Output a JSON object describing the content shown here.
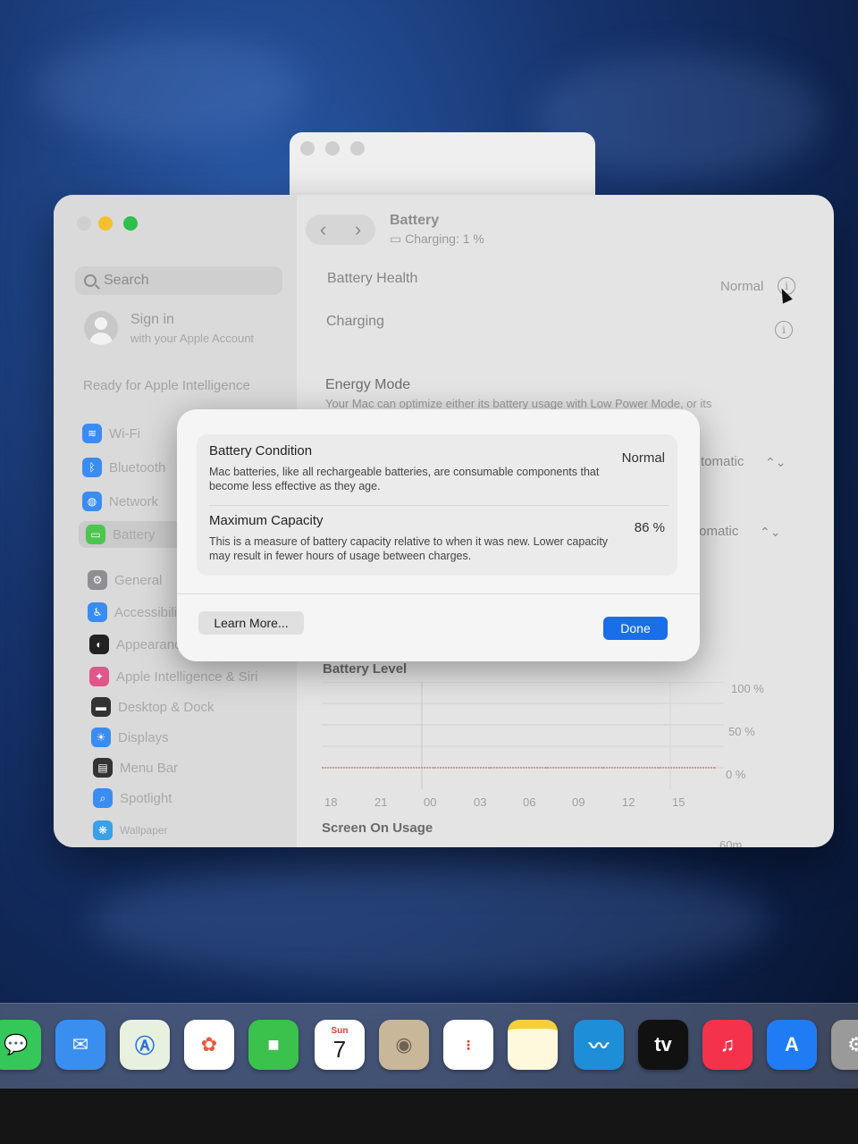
{
  "window": {
    "title": "Battery",
    "subtitle": "Charging: 1 %"
  },
  "sidebar": {
    "search_placeholder": "Search",
    "account_title": "Sign in",
    "account_sub": "with your Apple Account",
    "ready_text": "Ready for Apple Intelligence",
    "items": [
      {
        "label": "Wi-Fi",
        "icon": "wifi-icon",
        "color": "#3a8cf0"
      },
      {
        "label": "Bluetooth",
        "icon": "bluetooth-icon",
        "color": "#3a8cf0"
      },
      {
        "label": "Network",
        "icon": "globe-icon",
        "color": "#3a8cf0"
      },
      {
        "label": "Battery",
        "icon": "battery-icon",
        "color": "#4cc64f"
      },
      {
        "label": "General",
        "icon": "gear-icon",
        "color": "#8e8e93"
      },
      {
        "label": "Accessibili",
        "icon": "accessibility-icon",
        "color": "#3a8cf0"
      },
      {
        "label": "Appearance",
        "icon": "appearance-icon",
        "color": "#222222"
      },
      {
        "label": "Apple Intelligence & Siri",
        "icon": "siri-icon",
        "color": "#e0558a"
      },
      {
        "label": "Desktop & Dock",
        "icon": "dock-icon",
        "color": "#333333"
      },
      {
        "label": "Displays",
        "icon": "displays-icon",
        "color": "#3a8cf0"
      },
      {
        "label": "Menu Bar",
        "icon": "menubar-icon",
        "color": "#333333"
      },
      {
        "label": "Spotlight",
        "icon": "spotlight-icon",
        "color": "#3a8cf0"
      },
      {
        "label": "Wallpaper",
        "icon": "wallpaper-icon",
        "color": "#3aa0e8"
      }
    ]
  },
  "main": {
    "battery_health_label": "Battery Health",
    "battery_health_value": "Normal",
    "charging_label": "Charging",
    "energy_mode_label": "Energy Mode",
    "energy_mode_desc": "Your Mac can optimize either its battery usage with Low Power Mode, or its",
    "select_1_value": "tomatic",
    "select_2_value": "tomatic",
    "row_partial": "s",
    "battery_level_label": "Battery Level",
    "screen_on_label": "Screen On Usage",
    "partial_tick": "60m"
  },
  "chart_data": {
    "type": "line",
    "title": "Battery Level",
    "x": [
      "18",
      "21",
      "00",
      "03",
      "06",
      "09",
      "12",
      "15"
    ],
    "y_ticks": [
      "100 %",
      "50 %",
      "0 %"
    ],
    "ylim": [
      0,
      100
    ],
    "series": [
      {
        "values": [
          0,
          0,
          0,
          0,
          0,
          0,
          0,
          0
        ]
      }
    ]
  },
  "modal": {
    "condition_title": "Battery Condition",
    "condition_desc": "Mac batteries, like all rechargeable batteries, are consumable components that become less effective as they age.",
    "condition_value": "Normal",
    "capacity_title": "Maximum Capacity",
    "capacity_desc": "This is a measure of battery capacity relative to when it was new. Lower capacity may result in fewer hours of usage between charges.",
    "capacity_value": "86 %",
    "learn_more": "Learn More...",
    "done": "Done",
    "done_color": "#1a6ee8"
  },
  "dock": {
    "calendar_day": "Sun",
    "calendar_date": "7",
    "tv_label": "tv",
    "apps": [
      "Messages",
      "Mail",
      "Maps",
      "Photos",
      "FaceTime",
      "Calendar",
      "Contacts",
      "Reminders",
      "Notes",
      "Freeform",
      "TV",
      "Music",
      "App Store",
      "System Settings"
    ]
  }
}
